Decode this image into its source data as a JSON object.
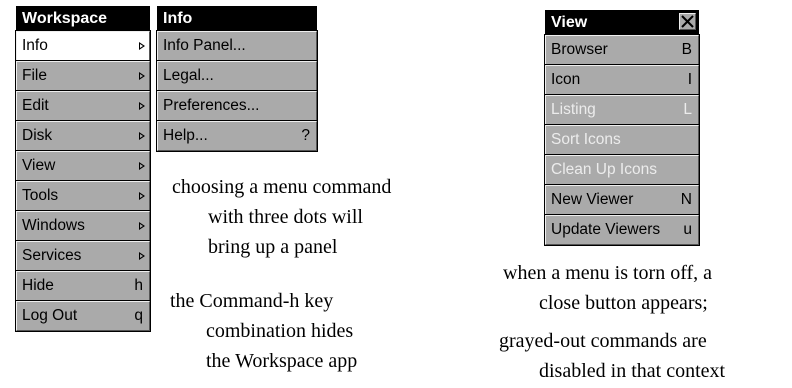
{
  "workspace_menu": {
    "title": "Workspace",
    "items": [
      {
        "label": "Info",
        "key": "",
        "submenu": true,
        "selected": true
      },
      {
        "label": "File",
        "key": "",
        "submenu": true
      },
      {
        "label": "Edit",
        "key": "",
        "submenu": true
      },
      {
        "label": "Disk",
        "key": "",
        "submenu": true
      },
      {
        "label": "View",
        "key": "",
        "submenu": true
      },
      {
        "label": "Tools",
        "key": "",
        "submenu": true
      },
      {
        "label": "Windows",
        "key": "",
        "submenu": true
      },
      {
        "label": "Services",
        "key": "",
        "submenu": true
      },
      {
        "label": "Hide",
        "key": "h"
      },
      {
        "label": "Log Out",
        "key": "q"
      }
    ]
  },
  "info_menu": {
    "title": "Info",
    "items": [
      {
        "label": "Info Panel...",
        "key": ""
      },
      {
        "label": "Legal...",
        "key": ""
      },
      {
        "label": "Preferences...",
        "key": ""
      },
      {
        "label": "Help...",
        "key": "?"
      }
    ]
  },
  "view_menu": {
    "title": "View",
    "close_icon": "close-x-icon",
    "items": [
      {
        "label": "Browser",
        "key": "B"
      },
      {
        "label": "Icon",
        "key": "I"
      },
      {
        "label": "Listing",
        "key": "L",
        "disabled": true
      },
      {
        "label": "Sort Icons",
        "key": "",
        "disabled": true
      },
      {
        "label": "Clean Up Icons",
        "key": "",
        "disabled": true
      },
      {
        "label": "New Viewer",
        "key": "N"
      },
      {
        "label": "Update Viewers",
        "key": "u"
      }
    ]
  },
  "captions": {
    "panel": [
      "choosing a menu command",
      "with three dots will",
      "bring up a panel"
    ],
    "hide": [
      "the Command-h key",
      "combination hides",
      "the Workspace app"
    ],
    "torn": [
      "when a menu is torn off, a",
      "close button appears;"
    ],
    "grayed": [
      "grayed-out commands are",
      "disabled in that context"
    ]
  }
}
